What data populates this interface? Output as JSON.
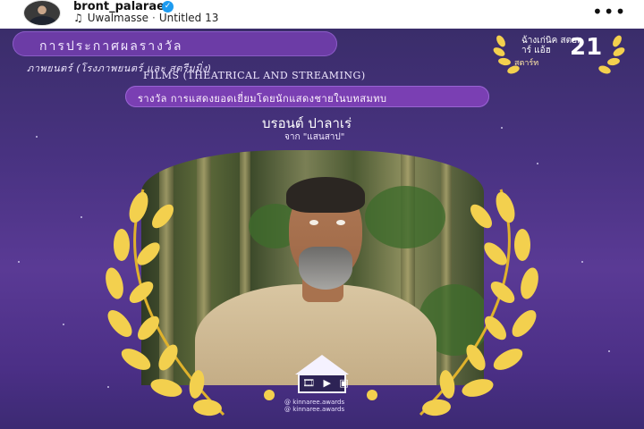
{
  "post": {
    "username": "bront_palarae",
    "audio_artist": "Uwalmasse",
    "audio_title": "Untitled 13",
    "more_icon": "more-horizontal-icon",
    "verified_icon": "verified-badge-icon",
    "music_icon": "music-note-icon"
  },
  "poster": {
    "announcement": "การประกาศผลรางวัล",
    "category_thai": "ภาพยนตร์ (โรงภาพยนตร์ และ สตรีมมิ่ง)",
    "category_en": "FILMS (THEATRICAL AND STREAMING)",
    "award_subcategory": "รางวัล การแสดงยอดเยี่ยมโดยนักแสดงชายในบทสมทบ",
    "winner_name": "บรอนต์ ปาลาเร่",
    "winner_film": "จาก \"แสนสาป\"",
    "festival_logo_thai": "ฉ้างเก่นิค สตอการ์ แอ้ฮ",
    "festival_number": "21",
    "festival_status": "สตาร์ท",
    "footer_icons": "🎞 ▶ ▣",
    "footer_social_1": "@ kinnaree.awards",
    "footer_social_2": "@ kinnaree.awards"
  },
  "colors": {
    "poster_bg": "#4a3383",
    "pill": "#6c3ca6",
    "laurel_gold": "#f3d04e",
    "verified": "#1d9bf0"
  }
}
